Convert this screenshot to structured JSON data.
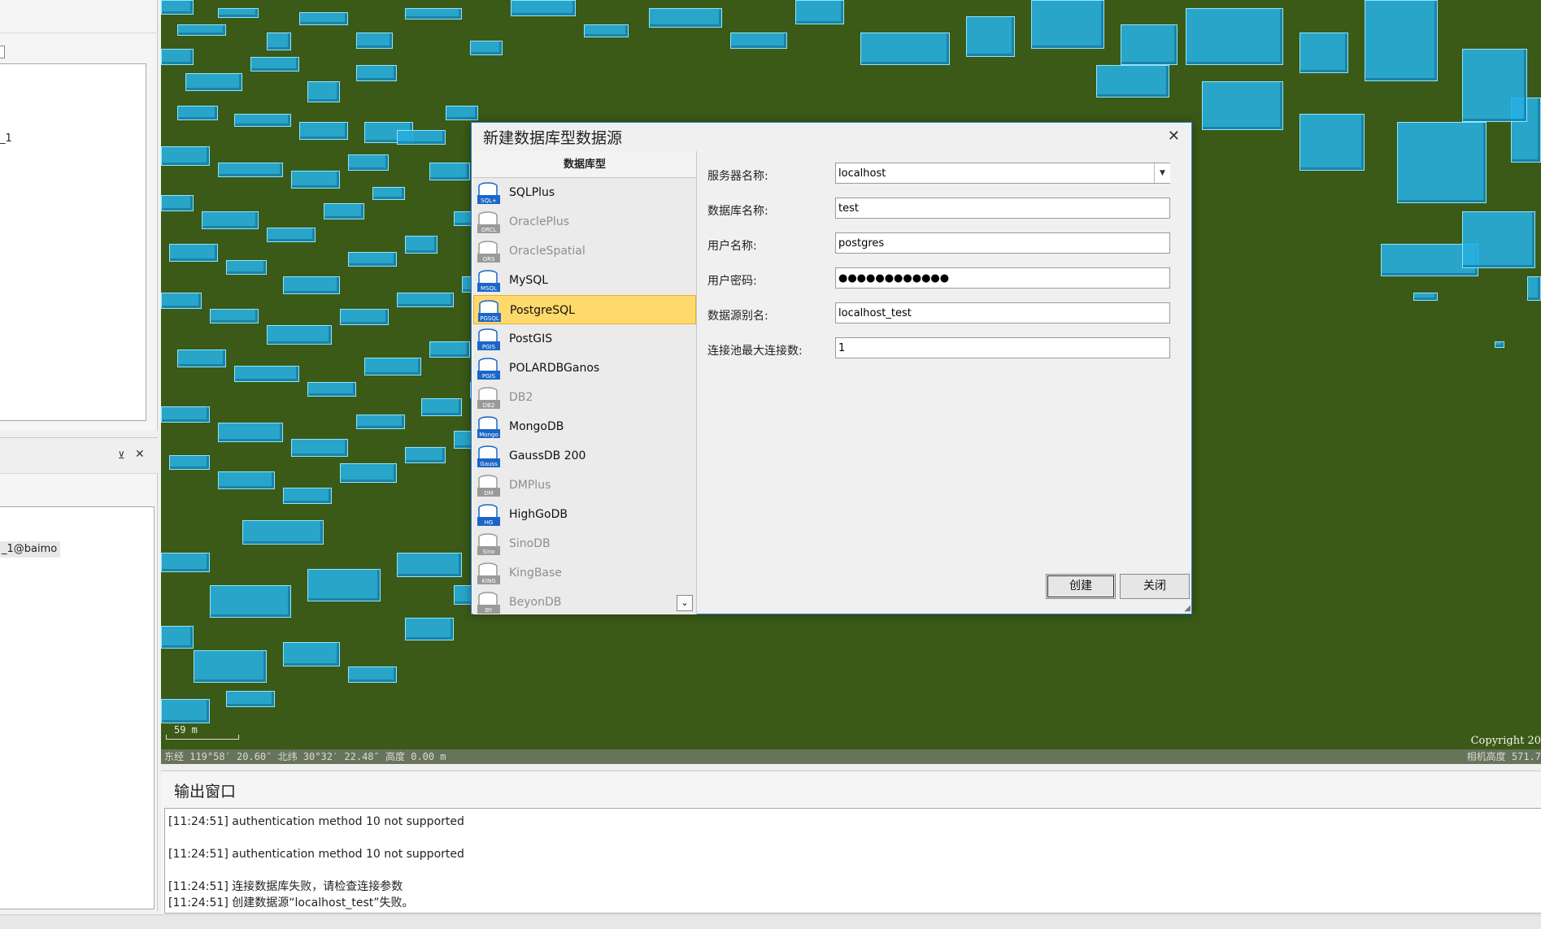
{
  "left_panel": {
    "tree_item": "_1",
    "datasource_item": "_1@baimo",
    "pin_glyph": "⊻",
    "close_glyph": "✕"
  },
  "scene": {
    "scale_text": "59 m",
    "coords_text": "东经 119°58′ 20.60″   北纬 30°32′ 22.48″   高度 0.00 m",
    "camera_text": "相机高度 571.7",
    "copyright": "Copyright 20"
  },
  "dialog": {
    "title": "新建数据库型数据源",
    "close_glyph": "✕",
    "list_header": "数据库型",
    "types": [
      {
        "label": "SQLPlus",
        "enabled": true,
        "badge": "SQL+",
        "color": "#1a66c9"
      },
      {
        "label": "OraclePlus",
        "enabled": false,
        "badge": "ORCL",
        "color": "#9a9a9a"
      },
      {
        "label": "OracleSpatial",
        "enabled": false,
        "badge": "ORS",
        "color": "#9a9a9a"
      },
      {
        "label": "MySQL",
        "enabled": true,
        "badge": "MSQL",
        "color": "#1a66c9"
      },
      {
        "label": "PostgreSQL",
        "enabled": true,
        "badge": "PGSQL",
        "color": "#1a66c9"
      },
      {
        "label": "PostGIS",
        "enabled": true,
        "badge": "PGIS",
        "color": "#1a66c9"
      },
      {
        "label": "POLARDBGanos",
        "enabled": true,
        "badge": "PGIS",
        "color": "#1a66c9"
      },
      {
        "label": "DB2",
        "enabled": false,
        "badge": "DB2",
        "color": "#9a9a9a"
      },
      {
        "label": "MongoDB",
        "enabled": true,
        "badge": "Mongo",
        "color": "#1a66c9"
      },
      {
        "label": "GaussDB 200",
        "enabled": true,
        "badge": "Gauss",
        "color": "#1a66c9"
      },
      {
        "label": "DMPlus",
        "enabled": false,
        "badge": "DM",
        "color": "#9a9a9a"
      },
      {
        "label": "HighGoDB",
        "enabled": true,
        "badge": "HG",
        "color": "#1a66c9"
      },
      {
        "label": "SinoDB",
        "enabled": false,
        "badge": "Sino",
        "color": "#9a9a9a"
      },
      {
        "label": "KingBase",
        "enabled": false,
        "badge": "KING",
        "color": "#9a9a9a"
      },
      {
        "label": "BeyonDB",
        "enabled": false,
        "badge": "BY",
        "color": "#9a9a9a"
      }
    ],
    "selected_type": "PostgreSQL",
    "scroll_glyph": "⌄",
    "fields": {
      "server": {
        "label": "服务器名称:",
        "value": "localhost"
      },
      "database": {
        "label": "数据库名称:",
        "value": "test"
      },
      "user": {
        "label": "用户名称:",
        "value": "postgres"
      },
      "password": {
        "label": "用户密码:",
        "value": "●●●●●●●●●●●●"
      },
      "alias": {
        "label": "数据源别名:",
        "value": "localhost_test"
      },
      "pool": {
        "label": "连接池最大连接数:",
        "value": "1"
      }
    },
    "dropdown_glyph": "▼",
    "create_label": "创建",
    "close_label": "关闭"
  },
  "output": {
    "title": "输出窗口",
    "lines": [
      "[11:24:51] authentication method 10 not supported",
      "",
      "[11:24:51] authentication method 10 not supported",
      "",
      "[11:24:51] 连接数据库失败，请检查连接参数",
      "[11:24:51] 创建数据源“localhost_test”失败。"
    ]
  },
  "colors": {
    "terrain": "#3b5a17",
    "building": "#26afe1",
    "selection": "#ffd96b",
    "dialog_border": "#2a7ad0"
  }
}
